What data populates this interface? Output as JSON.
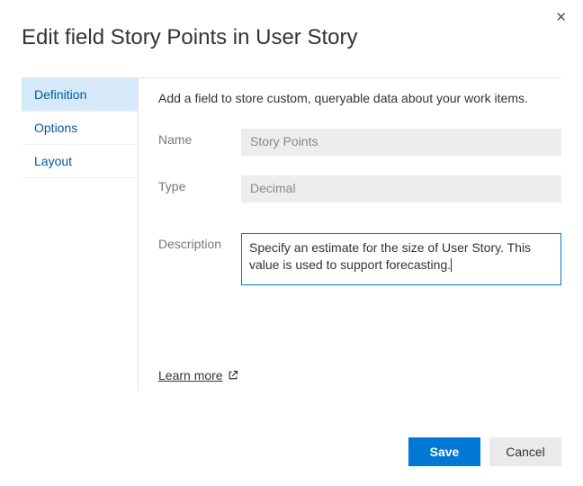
{
  "dialog": {
    "title": "Edit field Story Points in User Story",
    "close_icon": "✕"
  },
  "sidebar": {
    "items": [
      {
        "label": "Definition",
        "active": true
      },
      {
        "label": "Options",
        "active": false
      },
      {
        "label": "Layout",
        "active": false
      }
    ]
  },
  "main": {
    "helper_text": "Add a field to store custom, queryable data about your work items.",
    "name_label": "Name",
    "name_value": "Story Points",
    "type_label": "Type",
    "type_value": "Decimal",
    "description_label": "Description",
    "description_value": "Specify an estimate for the size of User Story. This value is used to support forecasting.",
    "learn_more_label": "Learn more"
  },
  "buttons": {
    "save": "Save",
    "cancel": "Cancel"
  }
}
